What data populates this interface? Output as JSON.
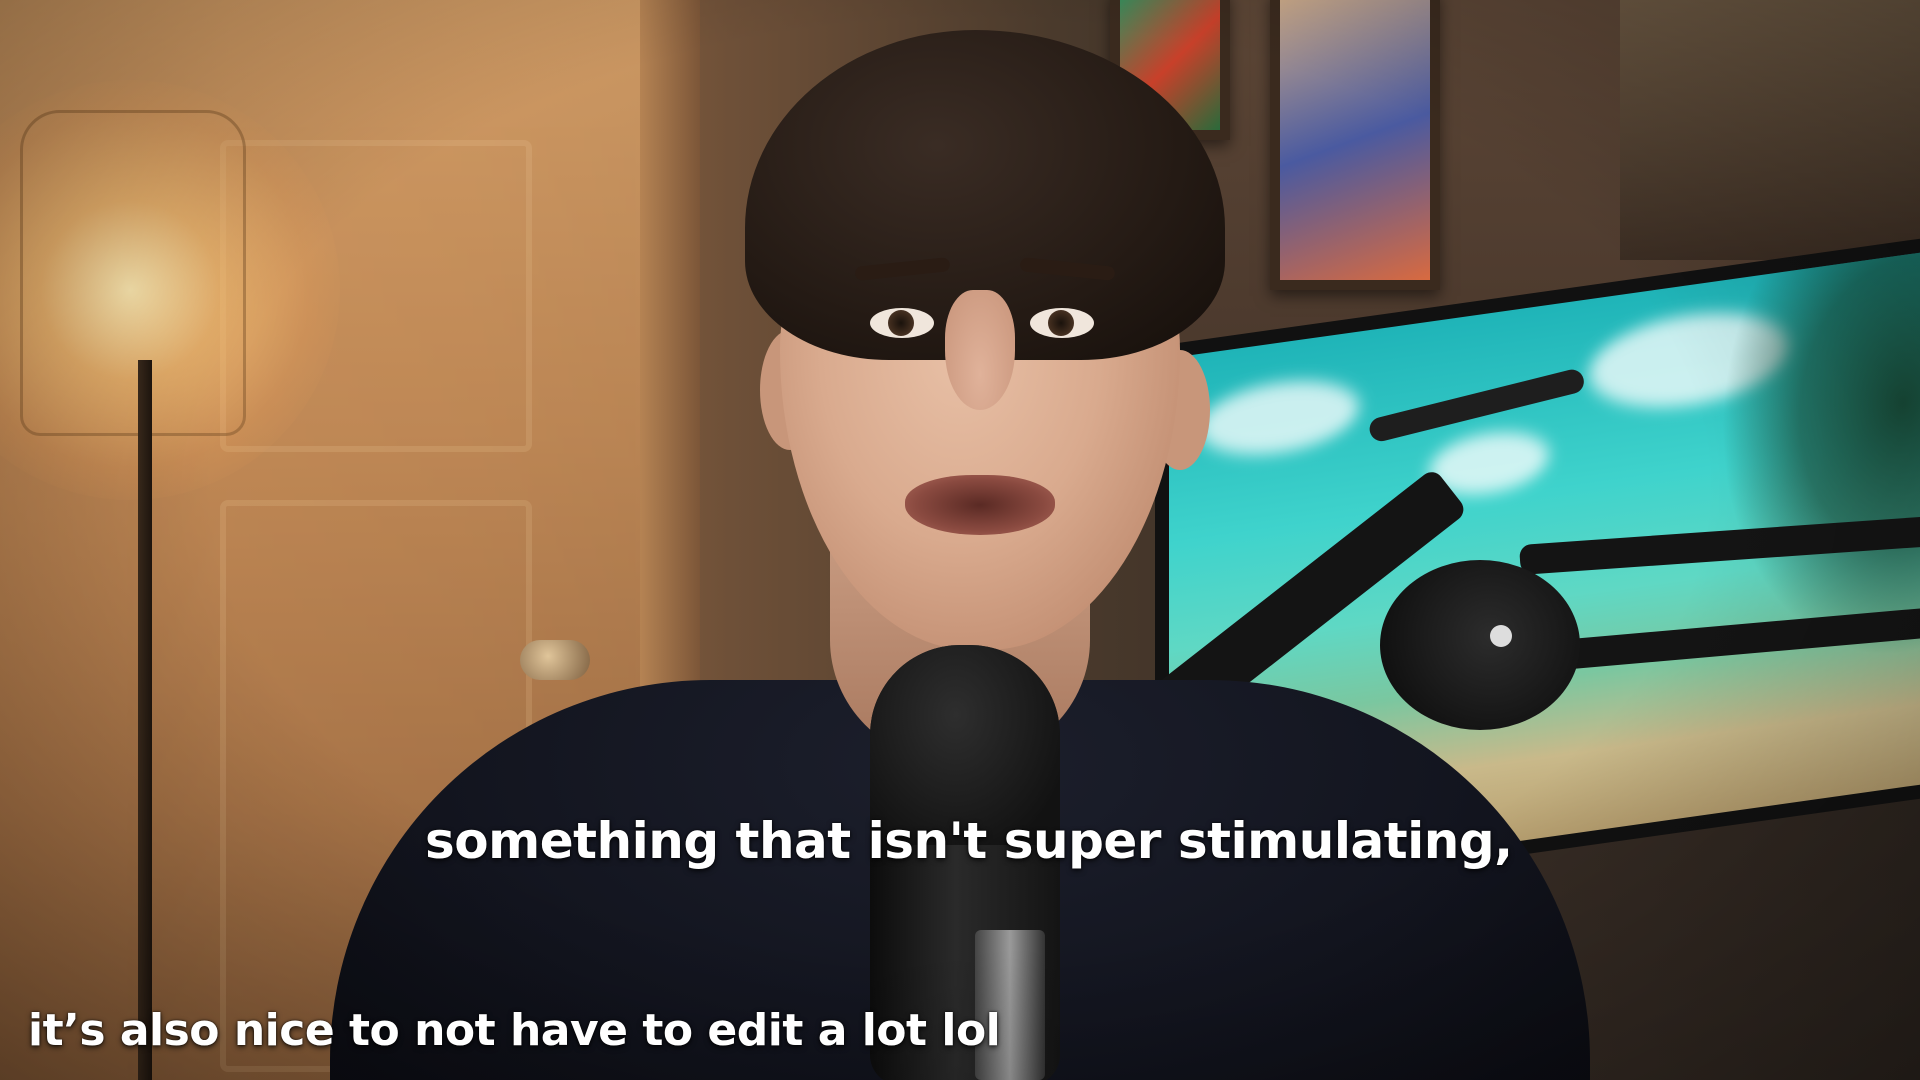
{
  "scene": {
    "colors": {
      "lamp_glow": "#ffecb4",
      "door": "#c48c58",
      "shirt": "#12141e",
      "screen_sky": "#3fd3cc",
      "microphone": "#141414"
    }
  },
  "captions": {
    "main": "something that isn't super stimulating,",
    "side": "it’s also nice to not have to edit a lot lol"
  }
}
